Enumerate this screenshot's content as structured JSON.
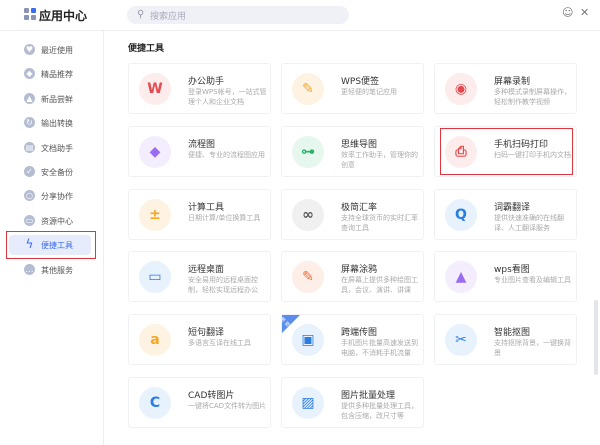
{
  "header": {
    "title": "应用中心",
    "search_placeholder": "搜索应用",
    "feedback_icon": "chat-icon",
    "close_icon": "close-icon"
  },
  "sidebar": {
    "items": [
      {
        "label": "最近使用",
        "icon": "heart-icon"
      },
      {
        "label": "精品推荐",
        "icon": "diamond-icon"
      },
      {
        "label": "新品尝鲜",
        "icon": "flame-icon"
      },
      {
        "label": "输出转换",
        "icon": "convert-icon"
      },
      {
        "label": "文档助手",
        "icon": "document-icon"
      },
      {
        "label": "安全备份",
        "icon": "shield-icon"
      },
      {
        "label": "分享协作",
        "icon": "share-icon"
      },
      {
        "label": "资源中心",
        "icon": "box-icon"
      },
      {
        "label": "便捷工具",
        "icon": "lightning-icon",
        "active": true
      },
      {
        "label": "其他服务",
        "icon": "more-icon"
      }
    ]
  },
  "section_title": "便捷工具",
  "apps": [
    {
      "name": "办公助手",
      "desc": "登录WPS帐号，一站式管理个人和企业文档",
      "icon": "wps-office-icon",
      "color": "#e5484d",
      "bg": "#fdecec",
      "glyph": "W"
    },
    {
      "name": "WPS便签",
      "desc": "更轻便的笔记应用",
      "icon": "leaf-note-icon",
      "color": "#f5a623",
      "bg": "#fef3e2",
      "glyph": "✎"
    },
    {
      "name": "屏幕录制",
      "desc": "多种模式录制屏幕操作，轻松制作教学视频",
      "icon": "screen-record-icon",
      "color": "#e5484d",
      "bg": "#fdecec",
      "glyph": "◉"
    },
    {
      "name": "流程图",
      "desc": "便捷、专业的流程图应用",
      "icon": "flowchart-icon",
      "color": "#9b6cf0",
      "bg": "#f3edfd",
      "glyph": "◆"
    },
    {
      "name": "思维导图",
      "desc": "效率工作助手，管理你的创意",
      "icon": "mindmap-icon",
      "color": "#27b36b",
      "bg": "#e6f7ee",
      "glyph": "⊶"
    },
    {
      "name": "手机扫码打印",
      "desc": "扫码一键打印手机内文档",
      "icon": "scan-print-icon",
      "color": "#e5484d",
      "bg": "#fdecec",
      "glyph": "⎙"
    },
    {
      "name": "计算工具",
      "desc": "日期计算/单位换算工具",
      "icon": "calculator-icon",
      "color": "#f5a623",
      "bg": "#fef3e2",
      "glyph": "±"
    },
    {
      "name": "极简汇率",
      "desc": "支持全球货币的实时汇率查询工具",
      "icon": "exchange-rate-icon",
      "color": "#555555",
      "bg": "#f0f0f0",
      "glyph": "∞"
    },
    {
      "name": "词霸翻译",
      "desc": "提供快速准确的在线翻译、人工翻译服务",
      "icon": "translate-icon",
      "color": "#2a7de1",
      "bg": "#e8f2fd",
      "glyph": "Q"
    },
    {
      "name": "远程桌面",
      "desc": "安全易用的远程桌面控制，轻松实现远程办公",
      "icon": "remote-desktop-icon",
      "color": "#2a7de1",
      "bg": "#e8f2fd",
      "glyph": "▭"
    },
    {
      "name": "屏幕涂鸦",
      "desc": "在屏幕上提供多种绘图工具，会议、演讲、讲课沟...",
      "icon": "screen-draw-icon",
      "color": "#f06a35",
      "bg": "#fdeee7",
      "glyph": "✎"
    },
    {
      "name": "wps看图",
      "desc": "专业图片查看及编辑工具",
      "icon": "image-viewer-icon",
      "color": "#9b6cf0",
      "bg": "#f3edfd",
      "glyph": "▲"
    },
    {
      "name": "短句翻译",
      "desc": "多语言互译在线工具",
      "icon": "sentence-translate-icon",
      "color": "#f5a623",
      "bg": "#fef3e2",
      "glyph": "a"
    },
    {
      "name": "跨端传图",
      "desc": "手机图片批量高速发送到电脑，不消耗手机流量",
      "icon": "cross-device-image-icon",
      "color": "#2a7de1",
      "bg": "#e8f2fd",
      "glyph": "▣",
      "badge": "推荐"
    },
    {
      "name": "智能抠图",
      "desc": "支持抠除背景，一键换背景",
      "icon": "smart-cutout-icon",
      "color": "#2a7de1",
      "bg": "#e8f2fd",
      "glyph": "✂"
    },
    {
      "name": "CAD转图片",
      "desc": "一键将CAD文件转为图片",
      "icon": "cad-to-image-icon",
      "color": "#2a7de1",
      "bg": "#e8f2fd",
      "glyph": "C"
    },
    {
      "name": "图片批量处理",
      "desc": "提供多种批量处理工具，包含压缩，改尺寸等",
      "icon": "batch-image-icon",
      "color": "#2a7de1",
      "bg": "#e8f2fd",
      "glyph": "▨"
    }
  ]
}
